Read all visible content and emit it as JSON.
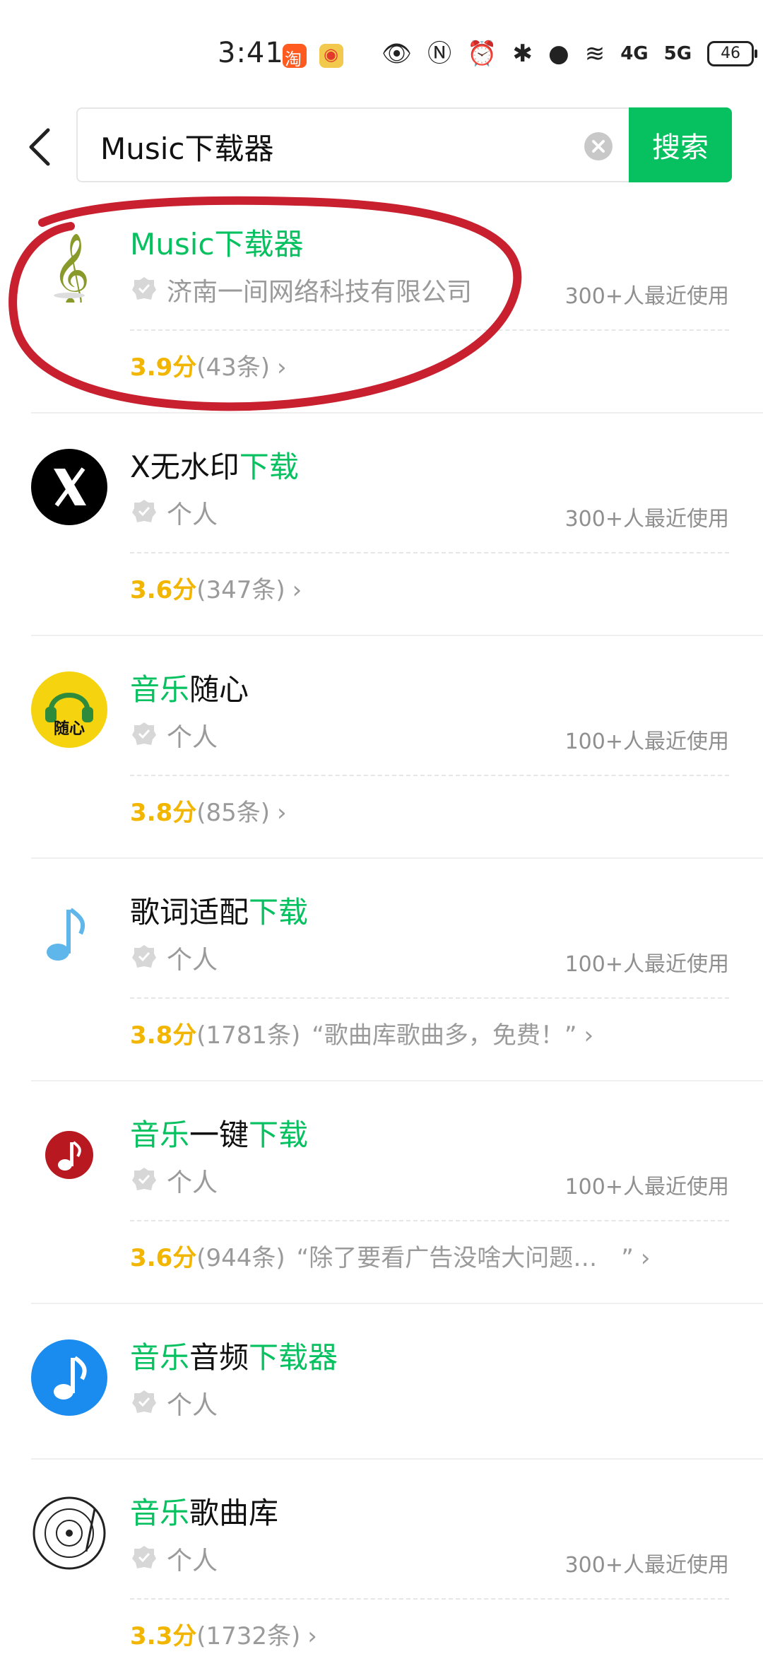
{
  "status_bar": {
    "time": "3:41",
    "network_1": "4G",
    "network_2": "5G",
    "battery": "46"
  },
  "search": {
    "query": "Music下载器",
    "button_label": "搜索"
  },
  "colors": {
    "accent_green": "#07c160",
    "rating_yellow": "#f2b500",
    "annotation_red": "#c8202f"
  },
  "results": [
    {
      "icon": "treble-clef-icon",
      "name_parts": [
        {
          "text": "Music下载器",
          "hl": true
        }
      ],
      "developer": "济南一间网络科技有限公司",
      "usage": "300+人最近使用",
      "score": "3.9分",
      "reviews": "(43条)",
      "quote": ""
    },
    {
      "icon": "x-logo-icon",
      "name_parts": [
        {
          "text": "X无水印",
          "hl": false
        },
        {
          "text": "下载",
          "hl": true
        }
      ],
      "developer": "个人",
      "usage": "300+人最近使用",
      "score": "3.6分",
      "reviews": "(347条)",
      "quote": ""
    },
    {
      "icon": "headphones-icon",
      "icon_text": "随心",
      "name_parts": [
        {
          "text": "音乐",
          "hl": true
        },
        {
          "text": "随心",
          "hl": false
        }
      ],
      "developer": "个人",
      "usage": "100+人最近使用",
      "score": "3.8分",
      "reviews": "(85条)",
      "quote": ""
    },
    {
      "icon": "music-note-icon",
      "name_parts": [
        {
          "text": "歌词适配",
          "hl": false
        },
        {
          "text": "下载",
          "hl": true
        }
      ],
      "developer": "个人",
      "usage": "100+人最近使用",
      "score": "3.8分",
      "reviews": "(1781条)",
      "quote": "“歌曲库歌曲多，免费！”"
    },
    {
      "icon": "red-music-note-icon",
      "name_parts": [
        {
          "text": "音乐",
          "hl": true
        },
        {
          "text": "一键",
          "hl": false
        },
        {
          "text": "下载",
          "hl": true
        }
      ],
      "developer": "个人",
      "usage": "100+人最近使用",
      "score": "3.6分",
      "reviews": "(944条)",
      "quote": "“除了要看广告没啥大问题…　”"
    },
    {
      "icon": "blue-music-note-icon",
      "name_parts": [
        {
          "text": "音乐",
          "hl": true
        },
        {
          "text": "音频",
          "hl": false
        },
        {
          "text": "下载器",
          "hl": true
        }
      ],
      "developer": "个人",
      "usage": "",
      "score": "",
      "reviews": "",
      "quote": ""
    },
    {
      "icon": "vinyl-record-icon",
      "name_parts": [
        {
          "text": "音乐",
          "hl": true
        },
        {
          "text": "歌曲库",
          "hl": false
        }
      ],
      "developer": "个人",
      "usage": "300+人最近使用",
      "score": "3.3分",
      "reviews": "(1732条)",
      "quote": ""
    }
  ]
}
